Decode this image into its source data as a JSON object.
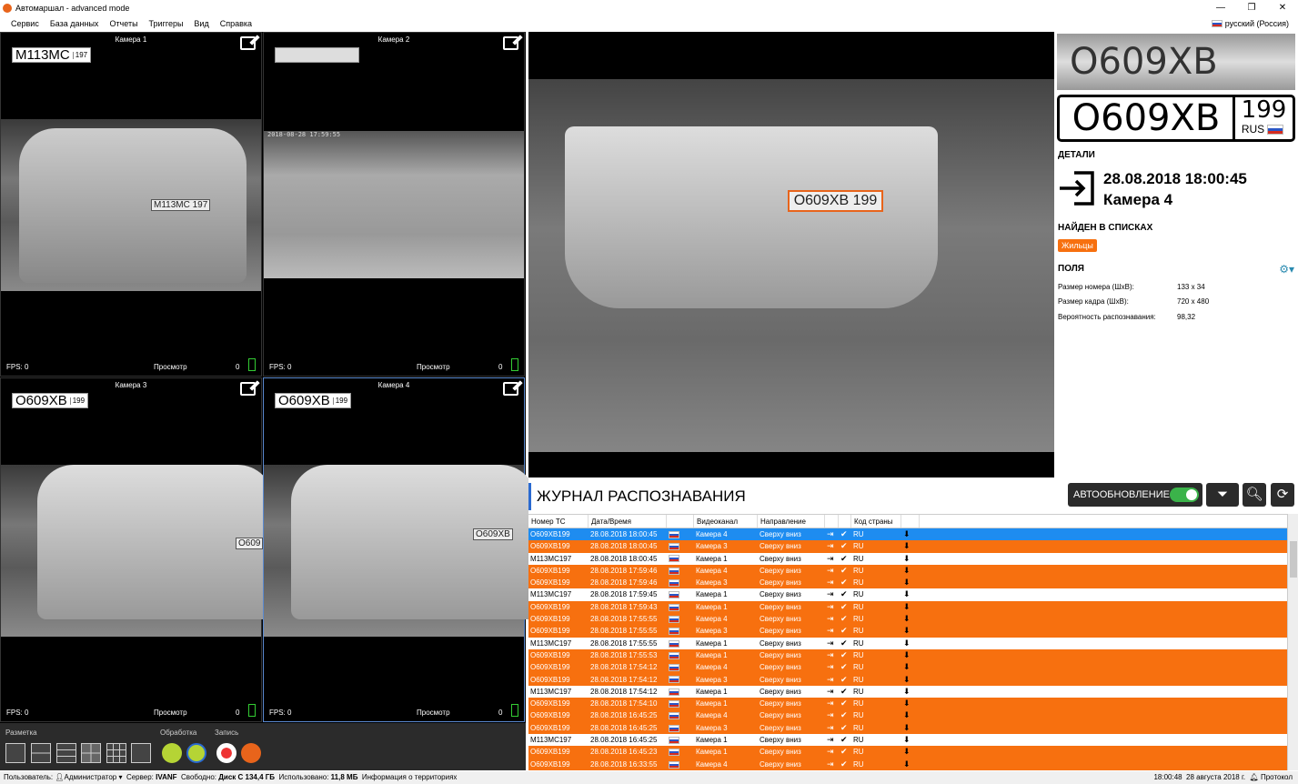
{
  "window": {
    "title": "Автомаршал - advanced mode",
    "min": "—",
    "max": "❐",
    "close": "✕"
  },
  "menu": [
    "Сервис",
    "База данных",
    "Отчеты",
    "Триггеры",
    "Вид",
    "Справка"
  ],
  "language": "русский (Россия)",
  "cameras": [
    {
      "name": "Камера 1",
      "plate": "М113МС",
      "region": "197",
      "fps_label": "FPS:",
      "fps": "0",
      "mode": "Просмотр",
      "count": "0",
      "car_plate": "М113МС 197"
    },
    {
      "name": "Камера 2",
      "plate": "",
      "region": "",
      "fps_label": "FPS:",
      "fps": "0",
      "mode": "Просмотр",
      "count": "0",
      "car_plate": ""
    },
    {
      "name": "Камера 3",
      "plate": "О609ХВ",
      "region": "199",
      "fps_label": "FPS:",
      "fps": "0",
      "mode": "Просмотр",
      "count": "0",
      "car_plate": "О609"
    },
    {
      "name": "Камера 4",
      "plate": "О609ХВ",
      "region": "199",
      "fps_label": "FPS:",
      "fps": "0",
      "mode": "Просмотр",
      "count": "0",
      "car_plate": "О609ХВ"
    }
  ],
  "camera2_overlay": "2018-08-28 17:59:55",
  "controls": {
    "layout_label": "Разметка",
    "processing_label": "Обработка",
    "record_label": "Запись"
  },
  "viewer": {
    "plate_overlay": "О609ХВ 199"
  },
  "details": {
    "plate_photo": "О609ХВ 199",
    "plate_number": "О609ХВ",
    "plate_region": "199",
    "plate_country": "RUS",
    "section_details": "ДЕТАЛИ",
    "datetime": "28.08.2018 18:00:45",
    "camera": "Камера 4",
    "section_lists": "НАЙДЕН В СПИСКАХ",
    "list_tag": "Жильцы",
    "section_fields": "ПОЛЯ",
    "fields": [
      {
        "label": "Размер номера (ШxВ):",
        "value": "133 x 34"
      },
      {
        "label": "Размер кадра (ШxВ):",
        "value": "720 x 480"
      },
      {
        "label": "Вероятность распознавания:",
        "value": "98,32"
      }
    ]
  },
  "journal": {
    "title": "ЖУРНАЛ РАСПОЗНАВАНИЯ",
    "autoupdate": "АВТООБНОВЛЕНИЕ",
    "columns": [
      "Номер ТС",
      "Дата/Время",
      "",
      "Видеоканал",
      "Направление",
      "",
      "",
      "Код страны",
      ""
    ],
    "rows": [
      {
        "plate": "О609ХВ199",
        "dt": "28.08.2018 18:00:45",
        "cam": "Камера 4",
        "dir": "Сверху вниз",
        "cc": "RU",
        "style": "sel"
      },
      {
        "plate": "О609ХВ199",
        "dt": "28.08.2018 18:00:45",
        "cam": "Камера 3",
        "dir": "Сверху вниз",
        "cc": "RU",
        "style": "orange"
      },
      {
        "plate": "М113МС197",
        "dt": "28.08.2018 18:00:45",
        "cam": "Камера 1",
        "dir": "Сверху вниз",
        "cc": "RU",
        "style": "white"
      },
      {
        "plate": "О609ХВ199",
        "dt": "28.08.2018 17:59:46",
        "cam": "Камера 4",
        "dir": "Сверху вниз",
        "cc": "RU",
        "style": "orange"
      },
      {
        "plate": "О609ХВ199",
        "dt": "28.08.2018 17:59:46",
        "cam": "Камера 3",
        "dir": "Сверху вниз",
        "cc": "RU",
        "style": "orange"
      },
      {
        "plate": "М113МС197",
        "dt": "28.08.2018 17:59:45",
        "cam": "Камера 1",
        "dir": "Сверху вниз",
        "cc": "RU",
        "style": "white"
      },
      {
        "plate": "О609ХВ199",
        "dt": "28.08.2018 17:59:43",
        "cam": "Камера 1",
        "dir": "Сверху вниз",
        "cc": "RU",
        "style": "orange"
      },
      {
        "plate": "О609ХВ199",
        "dt": "28.08.2018 17:55:55",
        "cam": "Камера 4",
        "dir": "Сверху вниз",
        "cc": "RU",
        "style": "orange"
      },
      {
        "plate": "О609ХВ199",
        "dt": "28.08.2018 17:55:55",
        "cam": "Камера 3",
        "dir": "Сверху вниз",
        "cc": "RU",
        "style": "orange"
      },
      {
        "plate": "М113МС197",
        "dt": "28.08.2018 17:55:55",
        "cam": "Камера 1",
        "dir": "Сверху вниз",
        "cc": "RU",
        "style": "white"
      },
      {
        "plate": "О609ХВ199",
        "dt": "28.08.2018 17:55:53",
        "cam": "Камера 1",
        "dir": "Сверху вниз",
        "cc": "RU",
        "style": "orange"
      },
      {
        "plate": "О609ХВ199",
        "dt": "28.08.2018 17:54:12",
        "cam": "Камера 4",
        "dir": "Сверху вниз",
        "cc": "RU",
        "style": "orange"
      },
      {
        "plate": "О609ХВ199",
        "dt": "28.08.2018 17:54:12",
        "cam": "Камера 3",
        "dir": "Сверху вниз",
        "cc": "RU",
        "style": "orange"
      },
      {
        "plate": "М113МС197",
        "dt": "28.08.2018 17:54:12",
        "cam": "Камера 1",
        "dir": "Сверху вниз",
        "cc": "RU",
        "style": "white"
      },
      {
        "plate": "О609ХВ199",
        "dt": "28.08.2018 17:54:10",
        "cam": "Камера 1",
        "dir": "Сверху вниз",
        "cc": "RU",
        "style": "orange"
      },
      {
        "plate": "О609ХВ199",
        "dt": "28.08.2018 16:45:25",
        "cam": "Камера 4",
        "dir": "Сверху вниз",
        "cc": "RU",
        "style": "orange"
      },
      {
        "plate": "О609ХВ199",
        "dt": "28.08.2018 16:45:25",
        "cam": "Камера 3",
        "dir": "Сверху вниз",
        "cc": "RU",
        "style": "orange"
      },
      {
        "plate": "М113МС197",
        "dt": "28.08.2018 16:45:25",
        "cam": "Камера 1",
        "dir": "Сверху вниз",
        "cc": "RU",
        "style": "white"
      },
      {
        "plate": "О609ХВ199",
        "dt": "28.08.2018 16:45:23",
        "cam": "Камера 1",
        "dir": "Сверху вниз",
        "cc": "RU",
        "style": "orange"
      },
      {
        "plate": "О609ХВ199",
        "dt": "28.08.2018 16:33:55",
        "cam": "Камера 4",
        "dir": "Сверху вниз",
        "cc": "RU",
        "style": "orange"
      }
    ]
  },
  "status": {
    "user_label": "Пользователь:",
    "user": "Администратор",
    "server_label": "Сервер:",
    "server": "IVANF",
    "free_label": "Свободно:",
    "free": "Диск С  134,4 ГБ",
    "used_label": "Использовано:",
    "used": "11,8 МБ",
    "info": "Информация о территориях",
    "time": "18:00:48",
    "date": "28 августа 2018 г.",
    "protocol": "Протокол"
  },
  "colors": {
    "accent": "#f7700f",
    "selection": "#1e8cf0",
    "toggle": "#3bb34a"
  }
}
